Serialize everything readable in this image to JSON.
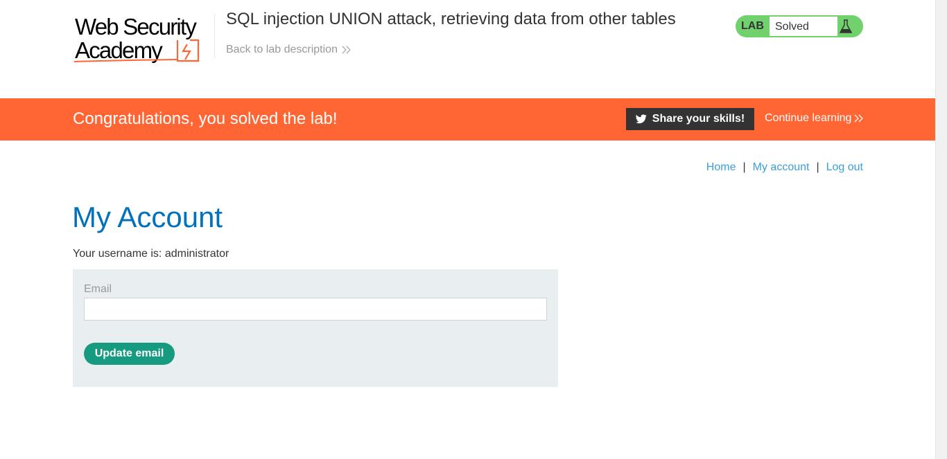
{
  "header": {
    "logo_line1": "Web Security",
    "logo_line2": "Academy",
    "lab_title": "SQL injection UNION attack, retrieving data from other tables",
    "back_link": "Back to lab description",
    "lab_badge": "LAB",
    "lab_status": "Solved",
    "status_color": "#70d16d"
  },
  "banner": {
    "message": "Congratulations, you solved the lab!",
    "share_label": "Share your skills!",
    "continue_label": "Continue learning",
    "color": "#ff6633"
  },
  "nav": {
    "home": "Home",
    "separator": "|",
    "my_account": "My account",
    "log_out": "Log out"
  },
  "main": {
    "title": "My Account",
    "username_text": "Your username is: administrator",
    "email_label": "Email",
    "email_value": "",
    "update_label": "Update email"
  },
  "icons": {
    "logo_mark": "lightning-box-icon",
    "back_chevron": "double-chevron-right-icon",
    "flask": "flask-icon",
    "twitter": "twitter-icon",
    "continue_chevron": "double-chevron-right-icon"
  }
}
